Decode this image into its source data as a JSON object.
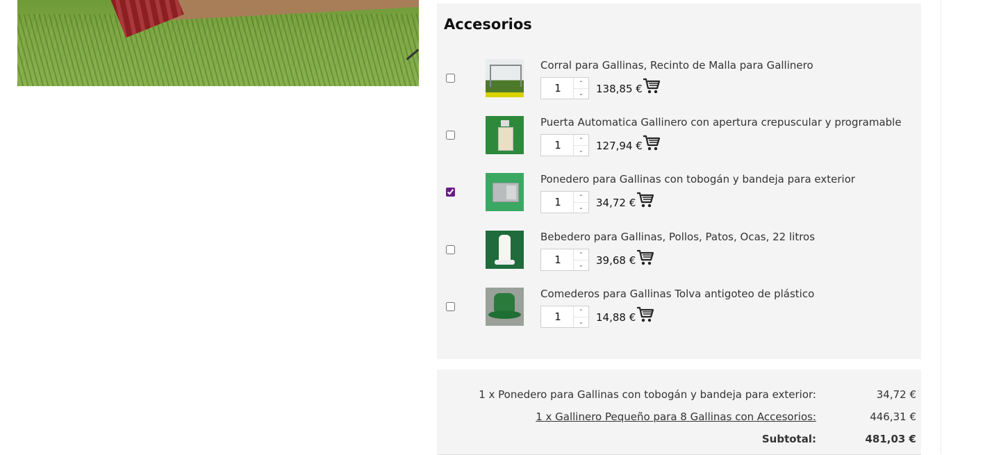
{
  "accessories": {
    "title": "Accesorios",
    "items": [
      {
        "name": "Corral para Gallinas, Recinto de Malla para Gallinero",
        "qty": "1",
        "price": "138,85 €",
        "checked": false
      },
      {
        "name": "Puerta Automatica Gallinero con apertura crepuscular y programable",
        "qty": "1",
        "price": "127,94 €",
        "checked": false
      },
      {
        "name": "Ponedero para Gallinas con tobogán y bandeja para exterior",
        "qty": "1",
        "price": "34,72 €",
        "checked": true
      },
      {
        "name": "Bebedero para Gallinas, Pollos, Patos, Ocas, 22 litros",
        "qty": "1",
        "price": "39,68 €",
        "checked": false
      },
      {
        "name": "Comederos para Gallinas Tolva antigoteo de plástico",
        "qty": "1",
        "price": "14,88 €",
        "checked": false
      }
    ]
  },
  "summary": {
    "lines": [
      {
        "label": "1 x Ponedero para Gallinas con tobogán y bandeja para exterior:",
        "amount": "34,72 €"
      },
      {
        "label": "1 x Gallinero Pequeño para 8 Gallinas con Accesorios:",
        "amount": "446,31 €"
      }
    ],
    "subtotal_label": "Subtotal:",
    "subtotal_amount": "481,03 €"
  },
  "colors": {
    "panel": "#f4f4f4",
    "checkbox_accent": "#6a1b8a"
  },
  "icons": {
    "cart": "shopping-cart-icon",
    "spinner_up": "chevron-up-icon",
    "spinner_down": "chevron-down-icon"
  }
}
